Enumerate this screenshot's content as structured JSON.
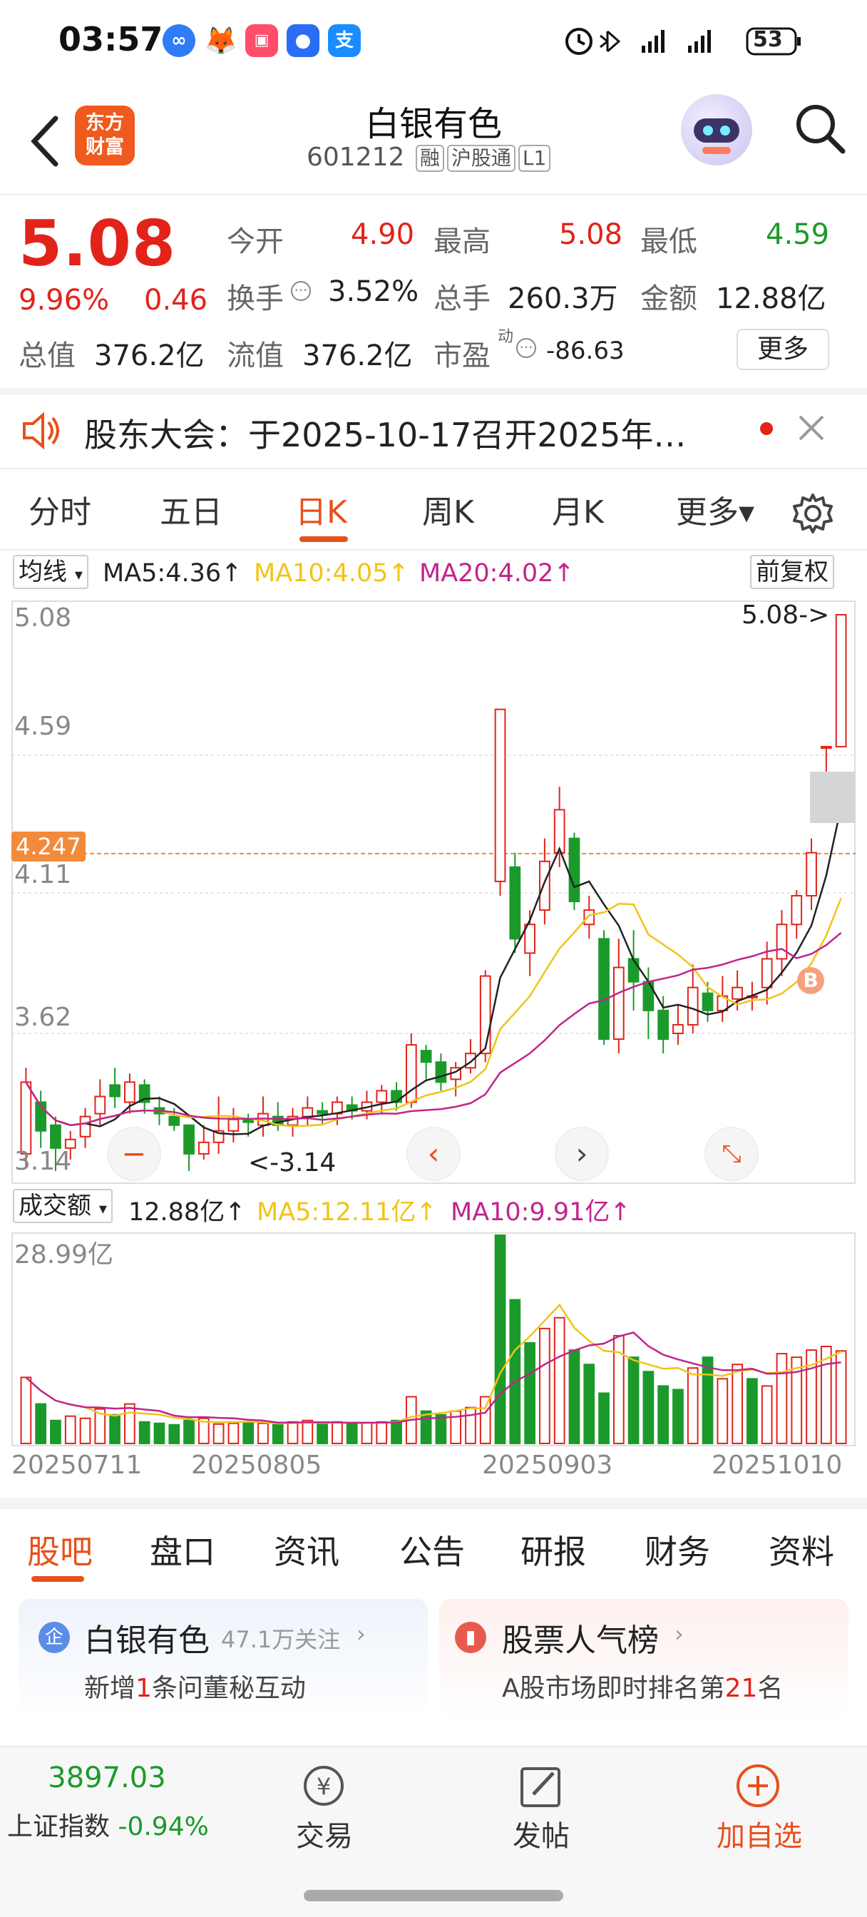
{
  "status": {
    "time": "03:57",
    "battery": "53"
  },
  "header": {
    "title": "白银有色",
    "code": "601212",
    "tags": [
      "融",
      "沪股通",
      "L1"
    ],
    "logo_text_1": "东方",
    "logo_text_2": "财富"
  },
  "quote": {
    "price": "5.08",
    "pct": "9.96%",
    "change": "0.46",
    "open_label": "今开",
    "open": "4.90",
    "high_label": "最高",
    "high": "5.08",
    "low_label": "最低",
    "low": "4.59",
    "turnover_label": "换手",
    "turnover": "3.52%",
    "volume_label": "总手",
    "volume": "260.3万",
    "amount_label": "金额",
    "amount": "12.88亿",
    "mktcap_label": "总值",
    "mktcap": "376.2亿",
    "float_label": "流值",
    "float": "376.2亿",
    "pe_label": "市盈",
    "pe_sup": "动",
    "pe": "-86.63",
    "more_label": "更多"
  },
  "notice": {
    "text": "股东大会：于2025-10-17召开2025年…"
  },
  "tabs": [
    "分时",
    "五日",
    "日K",
    "周K",
    "月K",
    "更多▾"
  ],
  "active_tab": "日K",
  "kline": {
    "indicator_label": "均线",
    "ma5": "MA5:4.36↑",
    "ma10": "MA10:4.05↑",
    "ma20": "MA20:4.02↑",
    "adjust_label": "前复权",
    "y_labels": [
      "5.08",
      "4.59",
      "4.11",
      "3.62",
      "3.14"
    ],
    "current_price_tag": "4.247",
    "high_marker": "5.08->",
    "low_marker": "<-3.14",
    "buy_marker": "B",
    "colors": {
      "up": "#e2231a",
      "down": "#1b9a2b",
      "ma5": "#222222",
      "ma10": "#f0c419",
      "ma20": "#c2248c",
      "accent": "#e8501a"
    }
  },
  "volume": {
    "indicator_label": "成交额",
    "value": "12.88亿↑",
    "ma5": "MA5:12.11亿↑",
    "ma10": "MA10:9.91亿↑",
    "max_label": "28.99亿"
  },
  "dates": [
    "20250711",
    "20250805",
    "20250903",
    "20251010"
  ],
  "chart_data": {
    "type": "candlestick",
    "y_range": [
      3.14,
      5.08
    ],
    "candles": [
      [
        3.2,
        3.45,
        3.15,
        3.5
      ],
      [
        3.38,
        3.28,
        3.22,
        3.42
      ],
      [
        3.3,
        3.22,
        3.14,
        3.33
      ],
      [
        3.22,
        3.25,
        3.18,
        3.28
      ],
      [
        3.26,
        3.33,
        3.22,
        3.36
      ],
      [
        3.34,
        3.4,
        3.3,
        3.46
      ],
      [
        3.44,
        3.4,
        3.36,
        3.5
      ],
      [
        3.38,
        3.45,
        3.34,
        3.48
      ],
      [
        3.44,
        3.38,
        3.34,
        3.46
      ],
      [
        3.36,
        3.34,
        3.3,
        3.4
      ],
      [
        3.33,
        3.3,
        3.28,
        3.36
      ],
      [
        3.3,
        3.2,
        3.14,
        3.3
      ],
      [
        3.2,
        3.24,
        3.18,
        3.3
      ],
      [
        3.24,
        3.28,
        3.2,
        3.4
      ],
      [
        3.28,
        3.32,
        3.24,
        3.36
      ],
      [
        3.32,
        3.31,
        3.26,
        3.34
      ],
      [
        3.3,
        3.34,
        3.26,
        3.4
      ],
      [
        3.33,
        3.3,
        3.28,
        3.38
      ],
      [
        3.3,
        3.33,
        3.26,
        3.36
      ],
      [
        3.33,
        3.36,
        3.3,
        3.4
      ],
      [
        3.35,
        3.34,
        3.3,
        3.38
      ],
      [
        3.34,
        3.38,
        3.3,
        3.4
      ],
      [
        3.37,
        3.35,
        3.32,
        3.4
      ],
      [
        3.35,
        3.38,
        3.32,
        3.42
      ],
      [
        3.38,
        3.42,
        3.34,
        3.44
      ],
      [
        3.42,
        3.38,
        3.35,
        3.45
      ],
      [
        3.38,
        3.58,
        3.36,
        3.62
      ],
      [
        3.56,
        3.52,
        3.46,
        3.58
      ],
      [
        3.52,
        3.45,
        3.42,
        3.55
      ],
      [
        3.46,
        3.5,
        3.4,
        3.52
      ],
      [
        3.5,
        3.55,
        3.48,
        3.6
      ],
      [
        3.55,
        3.82,
        3.52,
        3.84
      ],
      [
        4.15,
        4.75,
        4.1,
        4.75
      ],
      [
        4.2,
        3.95,
        3.9,
        4.25
      ],
      [
        3.9,
        4.0,
        3.82,
        4.05
      ],
      [
        4.05,
        4.22,
        4.0,
        4.3
      ],
      [
        4.25,
        4.4,
        4.2,
        4.48
      ],
      [
        4.3,
        4.08,
        4.05,
        4.32
      ],
      [
        4.0,
        4.05,
        3.95,
        4.1
      ],
      [
        3.95,
        3.6,
        3.58,
        3.98
      ],
      [
        3.6,
        3.85,
        3.55,
        3.95
      ],
      [
        3.88,
        3.8,
        3.7,
        3.98
      ],
      [
        3.8,
        3.7,
        3.6,
        3.85
      ],
      [
        3.7,
        3.6,
        3.55,
        3.75
      ],
      [
        3.62,
        3.65,
        3.58,
        3.72
      ],
      [
        3.65,
        3.78,
        3.62,
        3.86
      ],
      [
        3.76,
        3.7,
        3.66,
        3.8
      ],
      [
        3.7,
        3.75,
        3.66,
        3.82
      ],
      [
        3.74,
        3.78,
        3.7,
        3.84
      ],
      [
        3.75,
        3.75,
        3.7,
        3.8
      ],
      [
        3.78,
        3.88,
        3.72,
        3.94
      ],
      [
        3.88,
        4.0,
        3.82,
        4.05
      ],
      [
        4.0,
        4.1,
        3.95,
        4.12
      ],
      [
        4.1,
        4.25,
        4.05,
        4.3
      ],
      [
        4.62,
        4.62,
        4.45,
        4.62
      ],
      [
        4.62,
        5.08,
        4.62,
        5.08
      ]
    ],
    "volumes": [
      9.2,
      5.5,
      3.2,
      3.8,
      3.5,
      4.8,
      4.0,
      5.5,
      3.0,
      2.8,
      2.6,
      3.2,
      3.5,
      2.7,
      2.8,
      3.0,
      2.8,
      2.6,
      3.0,
      3.2,
      2.7,
      3.0,
      2.8,
      2.9,
      3.0,
      3.2,
      6.5,
      4.5,
      4.0,
      4.5,
      5.0,
      6.5,
      28.99,
      20.0,
      14.0,
      16.0,
      17.5,
      13.0,
      11.0,
      7.0,
      15.0,
      12.0,
      10.0,
      8.0,
      7.5,
      10.5,
      12.0,
      9.0,
      11.0,
      9.0,
      8.0,
      12.5,
      12.0,
      13.0,
      13.5,
      12.88
    ],
    "vol_up": [
      1,
      0,
      0,
      1,
      1,
      1,
      0,
      1,
      0,
      0,
      0,
      0,
      1,
      1,
      1,
      0,
      1,
      0,
      1,
      1,
      0,
      1,
      0,
      1,
      1,
      0,
      1,
      0,
      0,
      1,
      1,
      1,
      0,
      0,
      0,
      1,
      1,
      0,
      0,
      0,
      1,
      0,
      0,
      0,
      0,
      1,
      0,
      1,
      1,
      0,
      1,
      1,
      1,
      1,
      1,
      1
    ]
  },
  "bottom_tabs": [
    "股吧",
    "盘口",
    "资讯",
    "公告",
    "研报",
    "财务",
    "资料"
  ],
  "cards": {
    "left_title": "白银有色",
    "left_follow": "47.1万关注",
    "left_prefix": "新增",
    "left_num": "1",
    "left_suffix": "条问董秘互动",
    "right_title": "股票人气榜",
    "right_prefix": "A股市场即时排名第",
    "right_num": "21",
    "right_suffix": "名"
  },
  "bottombar": {
    "index_value": "3897.03",
    "index_name": "上证指数",
    "index_change": "-0.94%",
    "trade": "交易",
    "post": "发帖",
    "add": "加自选"
  }
}
